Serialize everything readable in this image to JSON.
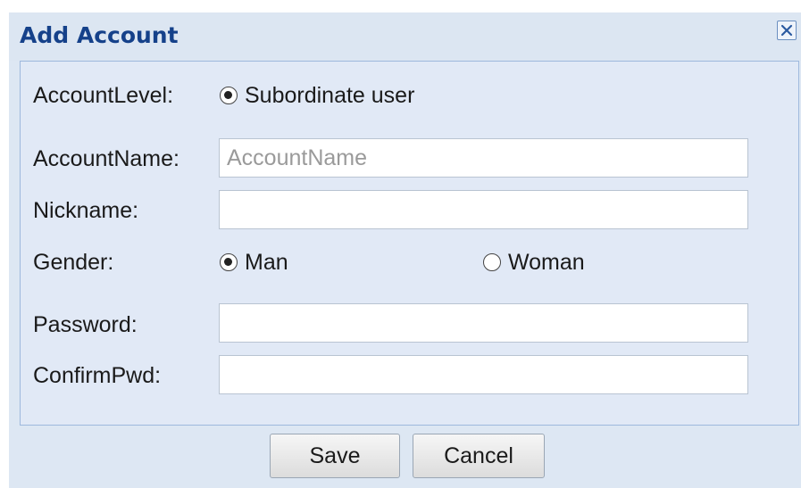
{
  "dialog": {
    "title": "Add Account",
    "close_icon": "close-icon"
  },
  "form": {
    "account_level": {
      "label": "AccountLevel:",
      "options": [
        {
          "label": "Subordinate user",
          "checked": true
        }
      ]
    },
    "account_name": {
      "label": "AccountName:",
      "value": "",
      "placeholder": "AccountName"
    },
    "nickname": {
      "label": "Nickname:",
      "value": "",
      "placeholder": ""
    },
    "gender": {
      "label": "Gender:",
      "options": [
        {
          "label": "Man",
          "checked": true
        },
        {
          "label": "Woman",
          "checked": false
        }
      ]
    },
    "password": {
      "label": "Password:",
      "value": "",
      "placeholder": ""
    },
    "confirm_pwd": {
      "label": "ConfirmPwd:",
      "value": "",
      "placeholder": ""
    }
  },
  "buttons": {
    "save_label": "Save",
    "cancel_label": "Cancel"
  },
  "colors": {
    "title_text": "#15418a",
    "dialog_bg": "#dde7f3",
    "panel_bg": "#e1e9f6",
    "panel_border": "#9db8dd"
  }
}
